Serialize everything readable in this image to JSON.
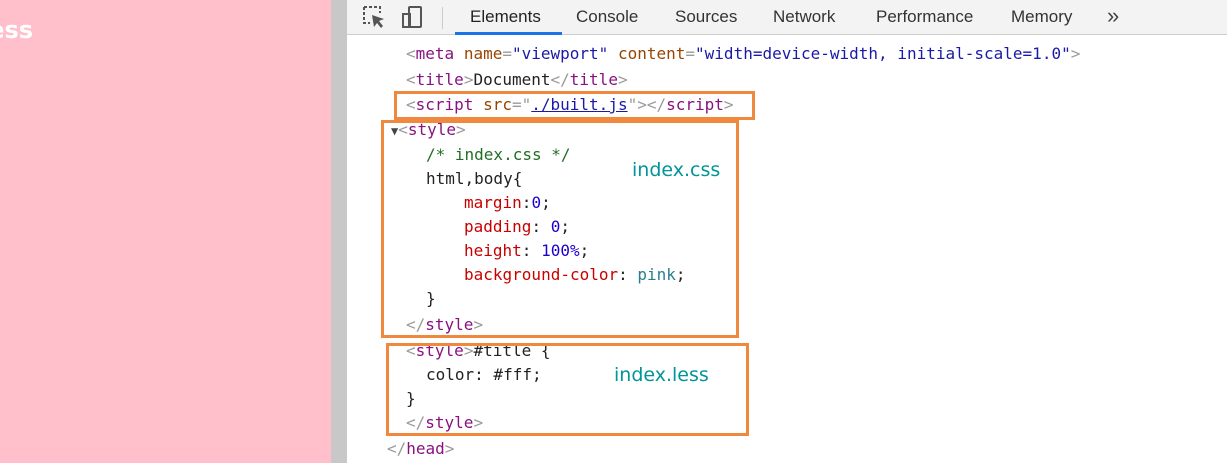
{
  "page": {
    "title_text": "less",
    "background": "#ffc0cb"
  },
  "toolbar": {
    "inspect_icon": "cursor-select-icon",
    "device_icon": "device-toggle-icon",
    "tabs": [
      "Elements",
      "Console",
      "Sources",
      "Network",
      "Performance",
      "Memory"
    ],
    "active_tab": "Elements",
    "more_label": "»"
  },
  "code": {
    "meta": {
      "tag": "meta",
      "a1": "name",
      "v1": "\"viewport\"",
      "a2": "content",
      "v2": "\"width=device-width, initial-scale=1.0\""
    },
    "title": {
      "tag": "title",
      "text": "Document"
    },
    "script": {
      "tag": "script",
      "attr": "src",
      "value": "./built.js"
    },
    "style1": {
      "tag": "style",
      "comment": "/* index.css */",
      "selector": "html,body{",
      "decls": [
        {
          "prop": "margin",
          "sep": ":",
          "val": "0"
        },
        {
          "prop": "padding",
          "sep": ": ",
          "val": "0"
        },
        {
          "prop": "height",
          "sep": ": ",
          "val": "100%"
        },
        {
          "prop": "background-color",
          "sep": ": ",
          "val": "pink"
        }
      ],
      "close": "}"
    },
    "style2": {
      "tag": "style",
      "selector": "#title {",
      "decl": "color: #fff;",
      "close": "}"
    },
    "head_close": "head"
  },
  "annotations": {
    "css_label": "index.css",
    "less_label": "index.less",
    "box_color": "#f0883e",
    "label_color": "#00959a"
  }
}
